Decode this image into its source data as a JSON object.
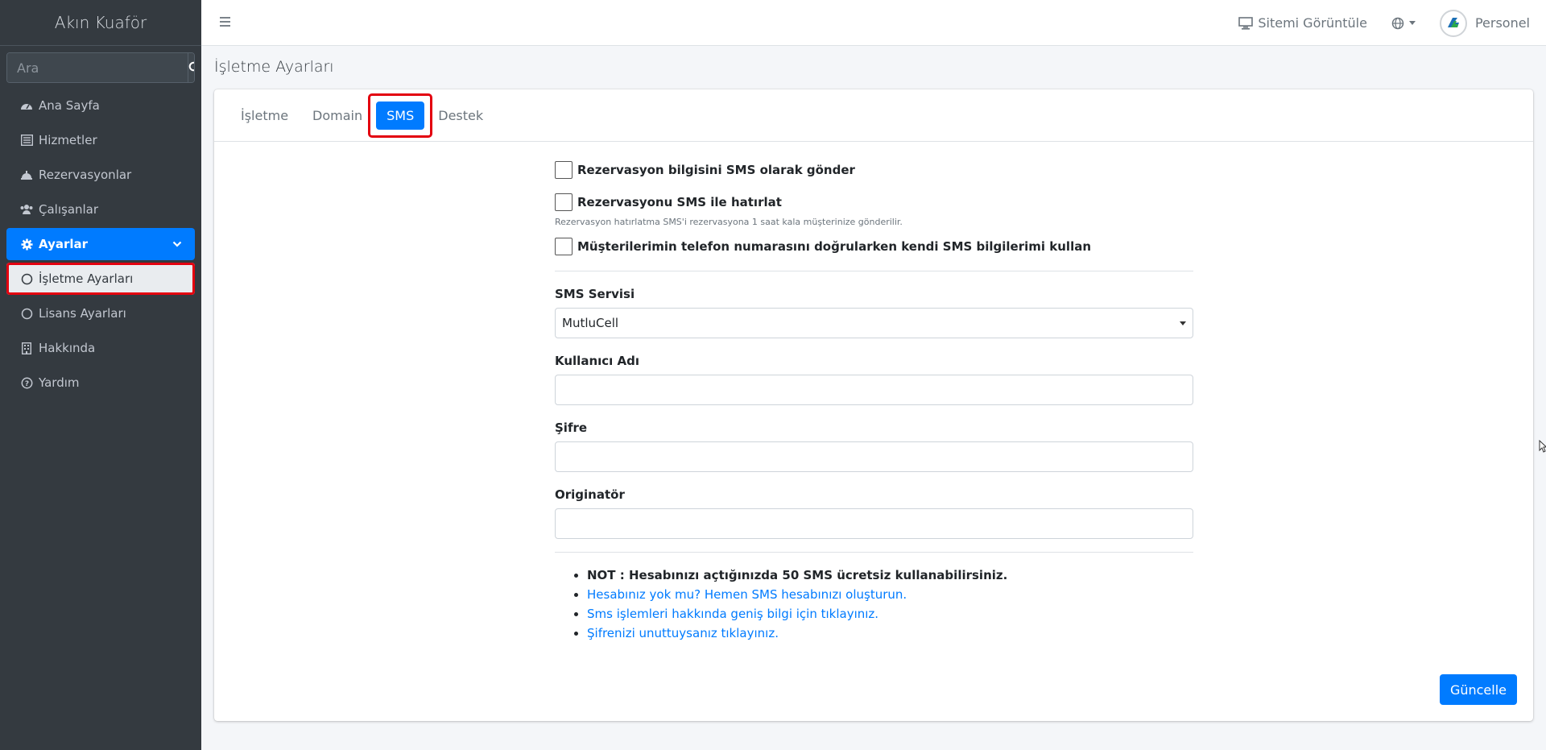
{
  "sidebar": {
    "brand": "Akın Kuaför",
    "search_placeholder": "Ara",
    "items": [
      {
        "label": "Ana Sayfa",
        "icon": "dashboard-icon"
      },
      {
        "label": "Hizmetler",
        "icon": "list-icon"
      },
      {
        "label": "Rezervasyonlar",
        "icon": "bell-concierge-icon"
      },
      {
        "label": "Çalışanlar",
        "icon": "users-icon"
      },
      {
        "label": "Ayarlar",
        "icon": "gear-icon"
      },
      {
        "label": "İşletme Ayarları",
        "icon": "circle-icon"
      },
      {
        "label": "Lisans Ayarları",
        "icon": "circle-icon"
      },
      {
        "label": "Hakkında",
        "icon": "building-icon"
      },
      {
        "label": "Yardım",
        "icon": "question-circle-icon"
      }
    ]
  },
  "header": {
    "view_site": "Sitemi Görüntüle",
    "user_name": "Personel"
  },
  "page": {
    "title": "İşletme Ayarları",
    "tabs": [
      "İşletme",
      "Domain",
      "SMS",
      "Destek"
    ],
    "active_tab": "SMS"
  },
  "sms": {
    "check_send": "Rezervasyon bilgisini SMS olarak gönder",
    "check_remind": "Rezervasyonu SMS ile hatırlat",
    "remind_hint": "Rezervasyon hatırlatma SMS'i rezervasyona 1 saat kala müşterinize gönderilir.",
    "check_own": "Müşterilerimin telefon numarasını doğrularken kendi SMS bilgilerimi kullan",
    "service_label": "SMS Servisi",
    "service_value": "MutluCell",
    "username_label": "Kullanıcı Adı",
    "username_value": "",
    "password_label": "Şifre",
    "password_value": "",
    "originator_label": "Originatör",
    "originator_value": "",
    "notes": [
      "NOT : Hesabınızı açtığınızda 50 SMS ücretsiz kullanabilirsiniz.",
      "Hesabınız yok mu? Hemen SMS hesabınızı oluşturun.",
      "Sms işlemleri hakkında geniş bilgi için tıklayınız.",
      "Şifrenizi unuttuysanız tıklayınız."
    ],
    "update_button": "Güncelle"
  },
  "colors": {
    "accent": "#007bff",
    "sidebar_bg": "#343a40",
    "highlight": "#e3000f"
  }
}
